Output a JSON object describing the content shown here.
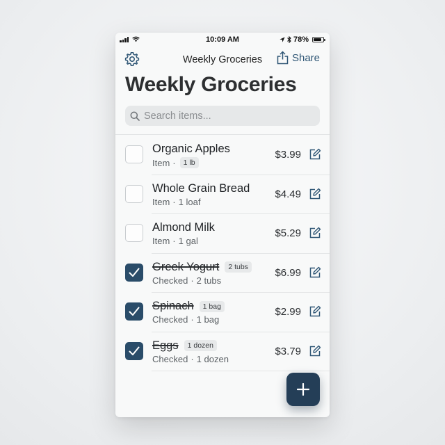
{
  "status_bar": {
    "time": "10:09 AM",
    "battery": "78%",
    "icons": [
      "signal-icon",
      "wifi-icon",
      "location-arrow-icon",
      "bluetooth-icon",
      "battery-icon"
    ]
  },
  "nav": {
    "title": "Weekly Groceries",
    "share_label": "Share",
    "left_icon": "gear-icon",
    "share_icon": "share-icon"
  },
  "page": {
    "title": "Weekly Groceries"
  },
  "search": {
    "placeholder": "Search items...",
    "value": ""
  },
  "items": [
    {
      "name": "Organic Apples",
      "status": "Item",
      "quantity": "1 lb",
      "price": "$3.99",
      "checked": false
    },
    {
      "name": "Whole Grain Bread",
      "status": "Item",
      "quantity": "1 loaf",
      "price": "$4.49",
      "checked": false
    },
    {
      "name": "Almond Milk",
      "status": "Item",
      "quantity": "1 gal",
      "price": "$5.29",
      "checked": false
    },
    {
      "name": "Greek Yogurt",
      "status": "Checked",
      "quantity": "2 tubs",
      "price": "$6.99",
      "checked": true
    },
    {
      "name": "Spinach",
      "status": "Checked",
      "quantity": "1 bag",
      "price": "$2.99",
      "checked": true
    },
    {
      "name": "Eggs",
      "status": "Checked",
      "quantity": "1 dozen",
      "price": "$3.79",
      "checked": true
    }
  ],
  "fab": {
    "icon": "plus-icon"
  },
  "colors": {
    "accent": "#2a4c69",
    "fab": "#243e57",
    "share": "#2f5675"
  }
}
